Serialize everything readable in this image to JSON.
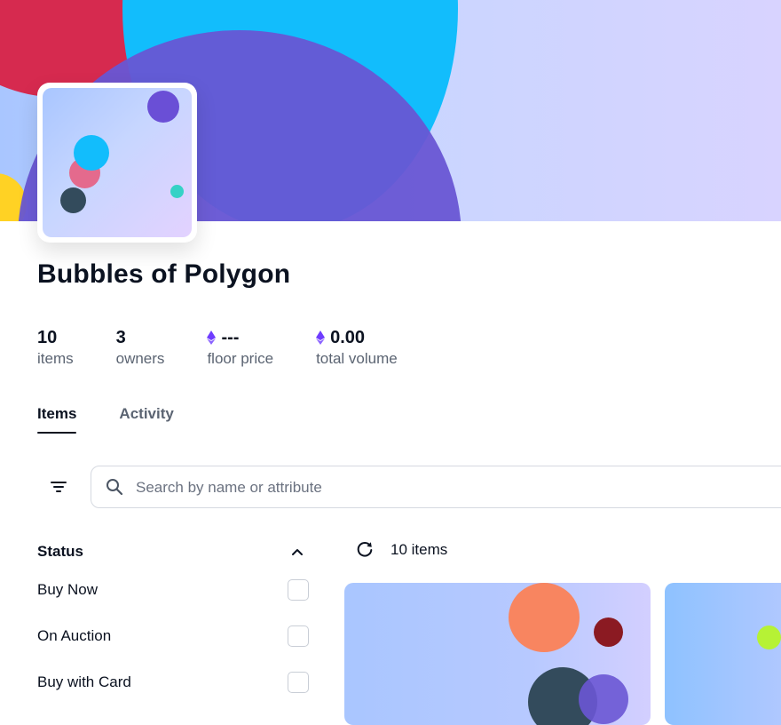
{
  "collection": {
    "title": "Bubbles of Polygon",
    "stats": [
      {
        "value": "10",
        "label": "items"
      },
      {
        "value": "3",
        "label": "owners"
      },
      {
        "value": "---",
        "label": "floor price",
        "currency": "eth"
      },
      {
        "value": "0.00",
        "label": "total volume",
        "currency": "eth"
      }
    ]
  },
  "tabs": [
    {
      "label": "Items",
      "active": true
    },
    {
      "label": "Activity",
      "active": false
    }
  ],
  "search": {
    "placeholder": "Search by name or attribute",
    "value": ""
  },
  "filters": {
    "status_heading": "Status",
    "items": [
      {
        "label": "Buy Now",
        "checked": false
      },
      {
        "label": "On Auction",
        "checked": false
      },
      {
        "label": "Buy with Card",
        "checked": false
      }
    ]
  },
  "results": {
    "count_text": "10 items"
  },
  "icons": {
    "filter": "filter-icon",
    "search": "search-icon",
    "chevron": "chevron-up-icon",
    "refresh": "refresh-icon",
    "eth": "ethereum-icon"
  },
  "colors": {
    "eth_purple": "#6f3cff"
  }
}
